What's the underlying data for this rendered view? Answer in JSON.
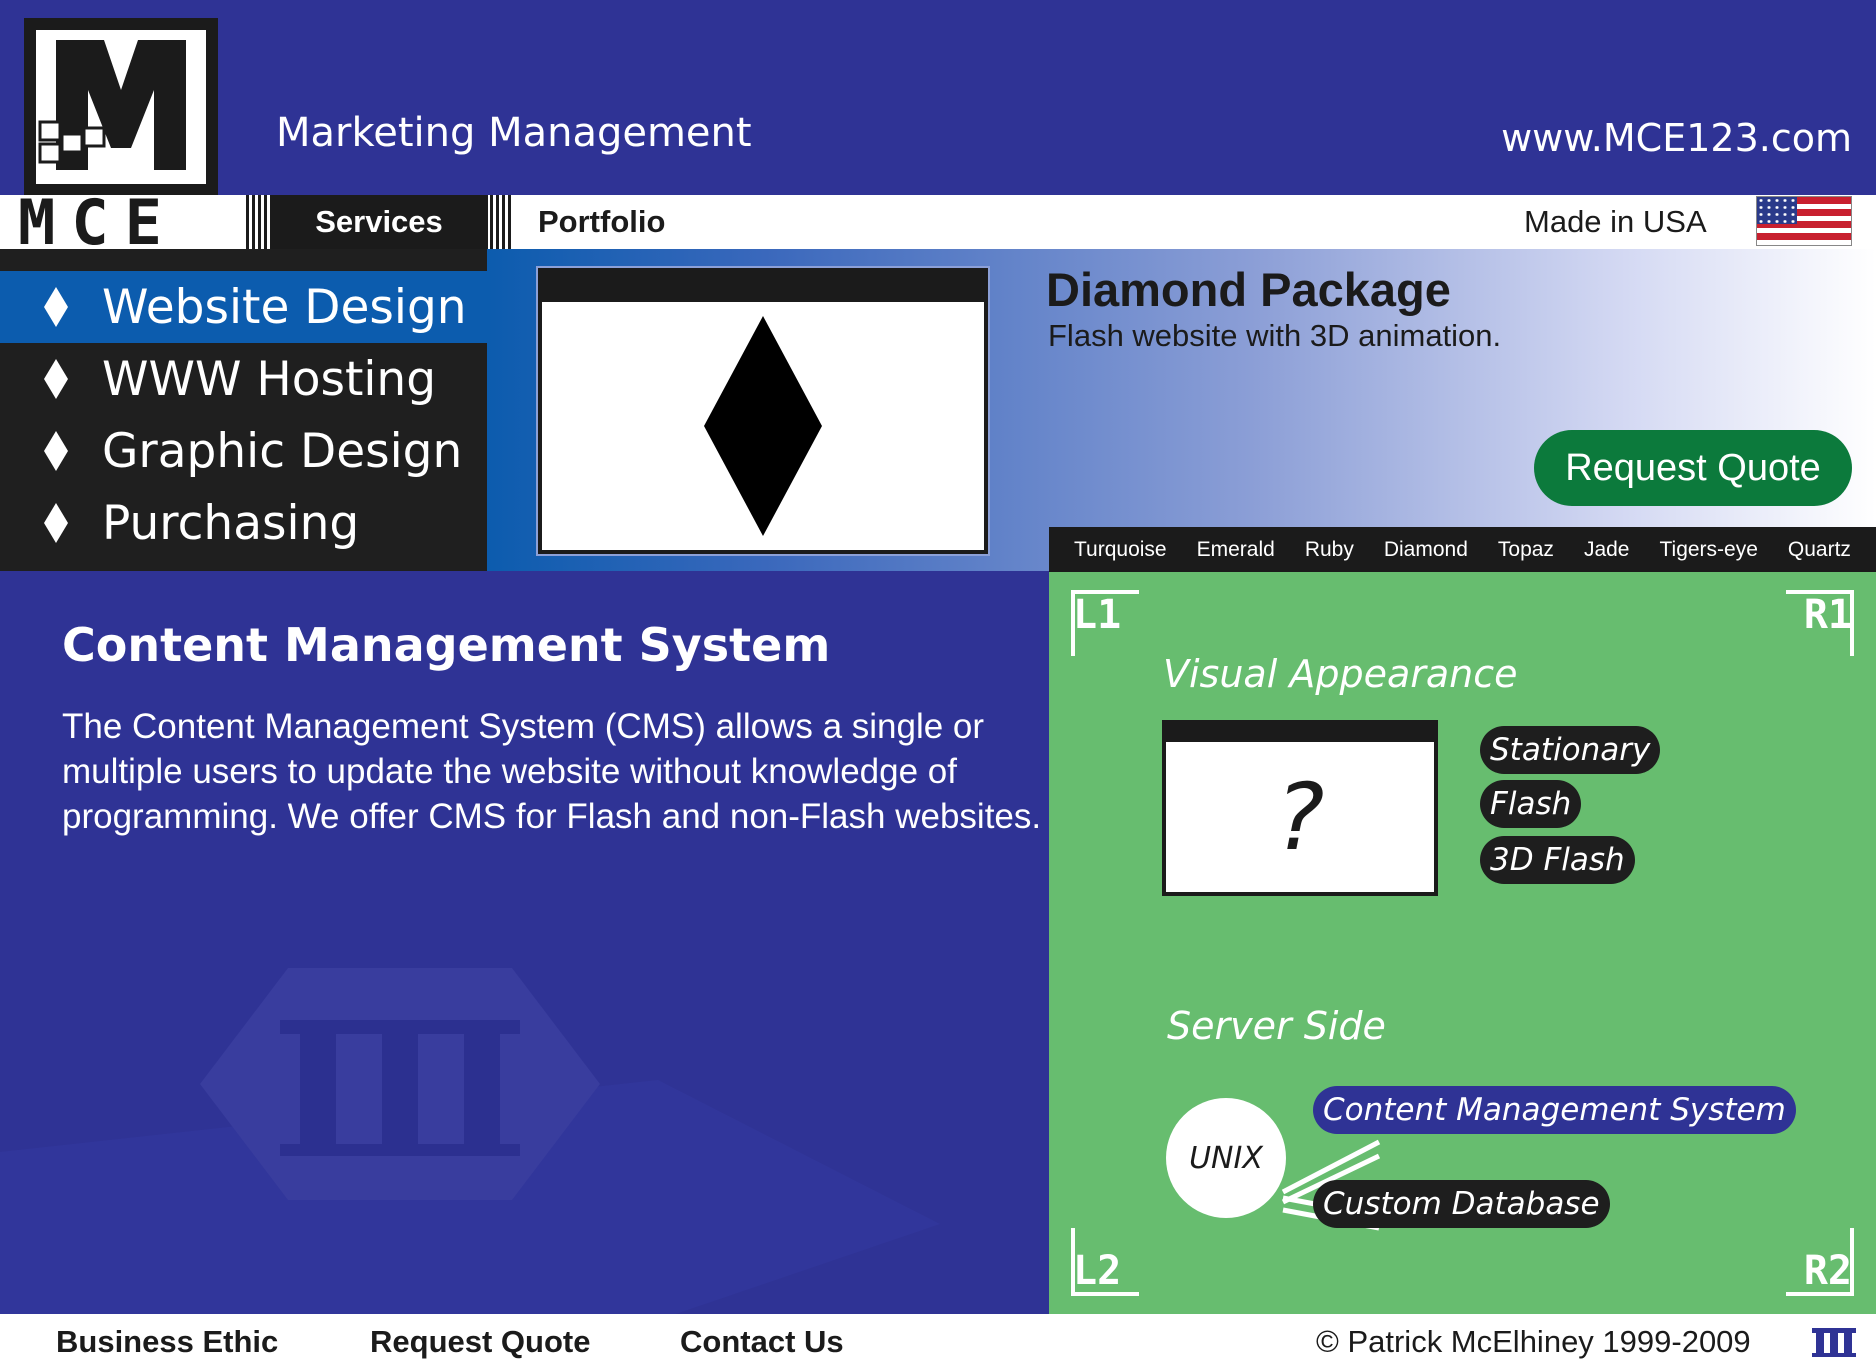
{
  "header": {
    "tagline": "Marketing Management",
    "url": "www.MCE123.com",
    "logo_text": "MCE"
  },
  "nav": {
    "services": "Services",
    "portfolio": "Portfolio",
    "made_in": "Made in USA"
  },
  "menu": {
    "items": [
      {
        "label": "Website Design",
        "active": true
      },
      {
        "label": "WWW Hosting",
        "active": false
      },
      {
        "label": "Graphic Design",
        "active": false
      },
      {
        "label": "Purchasing",
        "active": false
      }
    ]
  },
  "package": {
    "title": "Diamond Package",
    "description": "Flash website with 3D animation.",
    "request_quote": "Request Quote",
    "tabs": [
      "Turquoise",
      "Emerald",
      "Ruby",
      "Diamond",
      "Topaz",
      "Jade",
      "Tigers-eye",
      "Quartz"
    ]
  },
  "content": {
    "title": "Content Management System",
    "body": "The Content Management System (CMS) allows a single or multiple users to update the website without knowledge of programming. We offer CMS for Flash and non-Flash websites."
  },
  "panel": {
    "corners": {
      "tl": "L1",
      "tr": "R1",
      "bl": "L2",
      "br": "R2"
    },
    "visual_title": "Visual Appearance",
    "preview_symbol": "?",
    "visual_options": [
      "Stationary",
      "Flash",
      "3D Flash"
    ],
    "server_title": "Server Side",
    "server_os": "UNIX",
    "server_options": [
      "Content Management System",
      "Custom Database"
    ]
  },
  "footer": {
    "links": [
      "Business Ethic",
      "Request Quote",
      "Contact Us"
    ],
    "copyright": "© Patrick McElhiney 1999-2009"
  },
  "colors": {
    "background_blue": "#2f3395",
    "active_blue": "#0c5cae",
    "panel_green": "#67bd6f",
    "button_green": "#0c7a3c",
    "dark": "#1b1b1b"
  },
  "icons": {
    "menu_bullet": "diamond-icon",
    "flag": "us-flag-icon",
    "footer_logo": "columns-icon"
  }
}
